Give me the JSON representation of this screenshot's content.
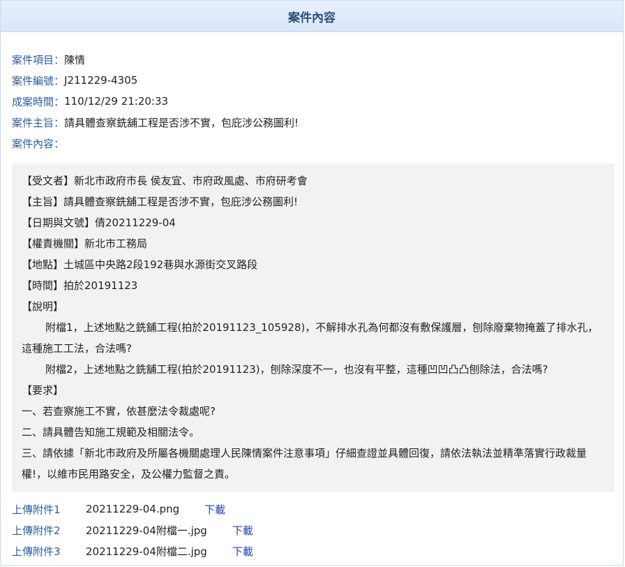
{
  "header": {
    "title": "案件內容"
  },
  "meta": {
    "item_label": "案件項目：",
    "item_value": "陳情",
    "id_label": "案件編號：",
    "id_value": "J211229-4305",
    "time_label": "成案時間：",
    "time_value": "110/12/29 21:20:33",
    "subject_label": "案件主旨：",
    "subject_value": "請具體查察銑舖工程是否涉不實，包庇涉公務圖利!",
    "content_label": "案件內容："
  },
  "content": {
    "lines": [
      "【受文者】新北市政府市長 侯友宜、市府政風處、市府研考會",
      "【主旨】請具體查察銑舖工程是否涉不實，包庇涉公務圖利!",
      "【日期與文號】倩20211229-04",
      "【權責機關】新北市工務局",
      "【地點】土城區中央路2段192巷與水源街交叉路段",
      "【時間】拍於20191123",
      "【說明】"
    ],
    "desc1": "附檔1，上述地點之銑舖工程(拍於20191123_105928)，不解排水孔為何都沒有敷保護層，刨除廢棄物掩蓋了排水孔，這種施工工法，合法嗎?",
    "desc2": "附檔2，上述地點之銑舖工程(拍於20191123)，刨除深度不一，也沒有平整，這種凹凹凸凸刨除法，合法嗎?",
    "req_title": "【要求】",
    "req1": "一、若查察施工不實，依甚麼法令裁處呢?",
    "req2": "二、請具體告知施工規範及相關法令。",
    "req3": "三、請依據「新北市政府及所屬各機關處理人民陳情案件注意事項」仔細查證並具體回復，請依法執法並精準落實行政裁量權!，以維市民用路安全，及公權力監督之責。"
  },
  "attachments": [
    {
      "label": "上傳附件1",
      "file": "20211229-04.png",
      "link": "下載"
    },
    {
      "label": "上傳附件2",
      "file": "20211229-04附檔一.jpg",
      "link": "下載"
    },
    {
      "label": "上傳附件3",
      "file": "20211229-04附檔二.jpg",
      "link": "下載"
    }
  ]
}
